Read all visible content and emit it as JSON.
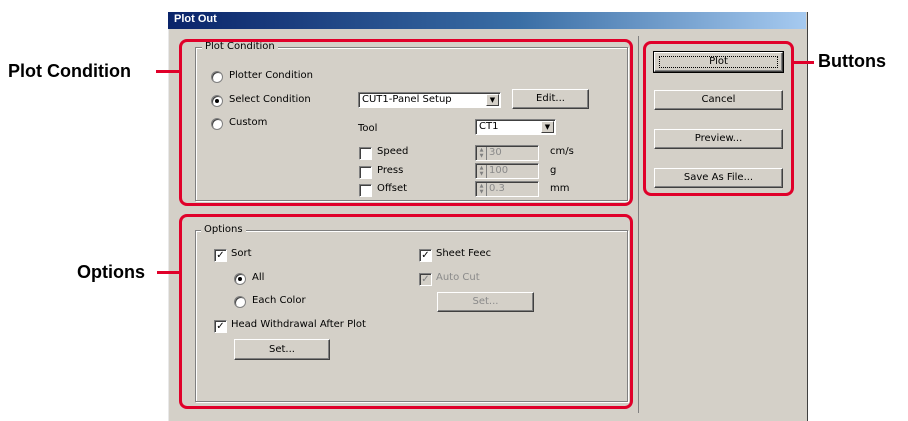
{
  "window": {
    "title": "Plot Out"
  },
  "plot_condition": {
    "legend": "Plot Condition",
    "options": [
      {
        "label": "Plotter Condition",
        "selected": false
      },
      {
        "label": "Select Condition",
        "selected": true
      },
      {
        "label": "Custom",
        "selected": false
      }
    ],
    "condition_select": {
      "value": "CUT1-Panel Setup"
    },
    "edit_button": "Edit...",
    "tool": {
      "label": "Tool",
      "value": "CT1"
    },
    "speed": {
      "label": "Speed",
      "value": "30",
      "unit": "cm/s",
      "checked": false
    },
    "press": {
      "label": "Press",
      "value": "100",
      "unit": "g",
      "checked": false
    },
    "offset": {
      "label": "Offset",
      "value": "0.3",
      "unit": "mm",
      "checked": false
    }
  },
  "options": {
    "legend": "Options",
    "sort": {
      "label": "Sort",
      "checked": true
    },
    "all": {
      "label": "All",
      "selected": true
    },
    "each_color": {
      "label": "Each Color",
      "selected": false
    },
    "head_withdrawal": {
      "label": "Head Withdrawal After Plot",
      "checked": true
    },
    "set_button": "Set...",
    "sheet_feed": {
      "label": "Sheet Feec",
      "checked": true
    },
    "auto_cut": {
      "label": "Auto Cut",
      "checked": true,
      "disabled": true
    },
    "auto_cut_set_button": "Set..."
  },
  "buttons": {
    "plot": "Plot",
    "cancel": "Cancel",
    "preview": "Preview...",
    "save_as_file": "Save As File..."
  },
  "annotations": {
    "plot_condition": "Plot Condition",
    "options": "Options",
    "buttons": "Buttons",
    "color": "#e0002a"
  },
  "checkmark_glyph": "✓"
}
